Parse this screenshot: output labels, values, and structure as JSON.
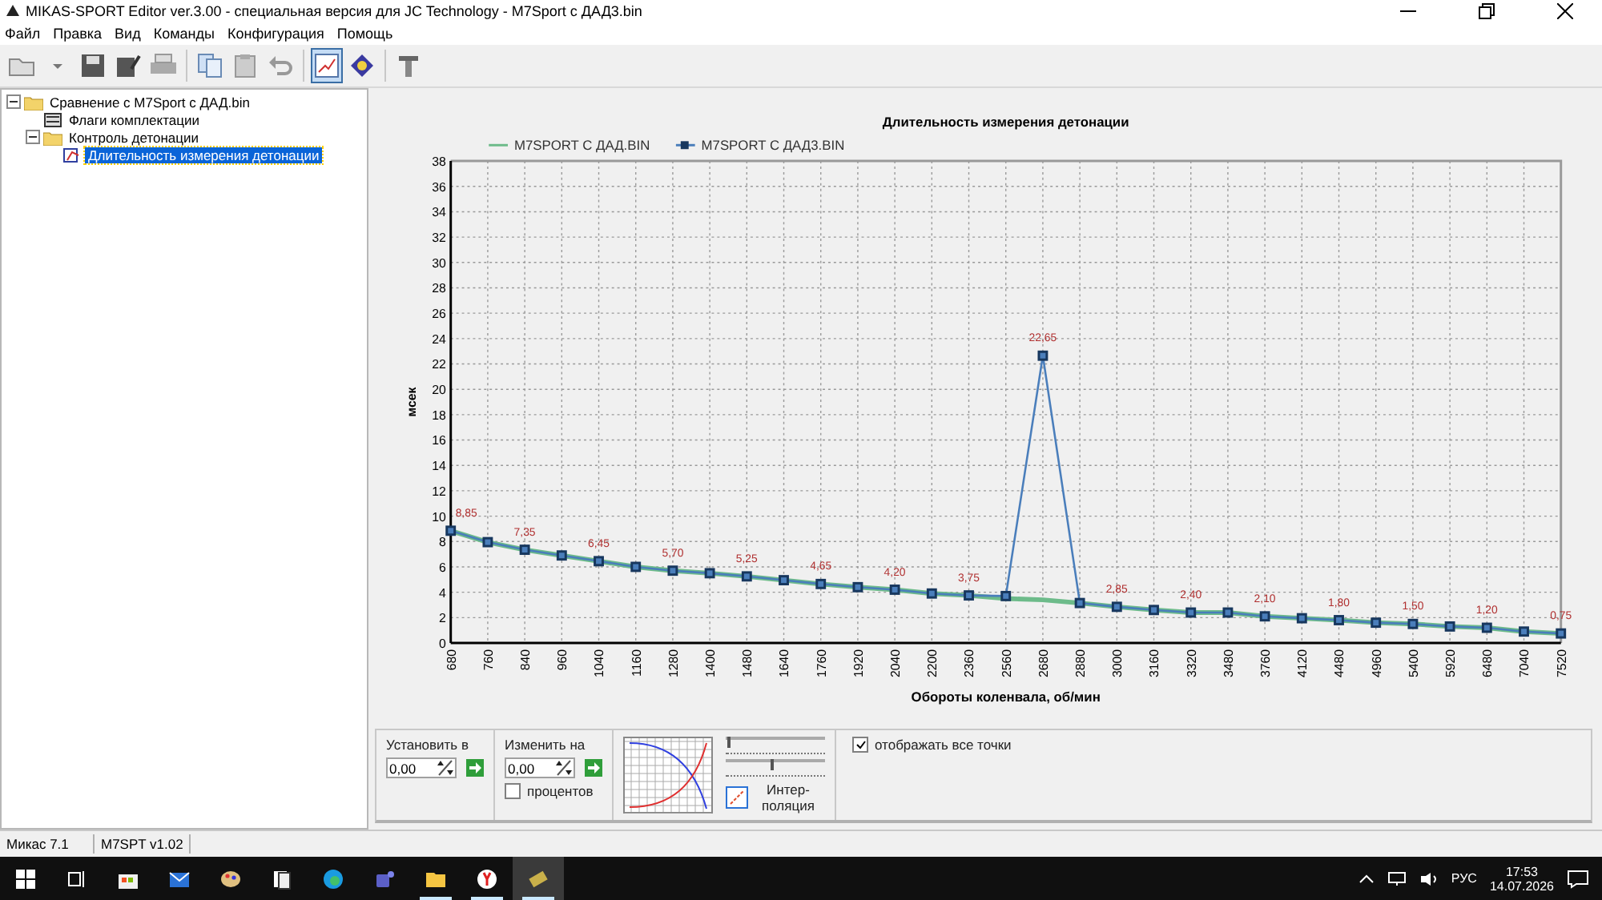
{
  "window": {
    "title": "MIKAS-SPORT Editor ver.3.00 - специальная версия для JC Technology - M7Sport с ДАД3.bin"
  },
  "menu": [
    "Файл",
    "Правка",
    "Вид",
    "Команды",
    "Конфигурация",
    "Помощь"
  ],
  "toolbar": [
    [
      {
        "kind": "open",
        "pressed": false
      },
      {
        "kind": "caret",
        "pressed": false
      },
      {
        "kind": "save",
        "pressed": false
      },
      {
        "kind": "saveas",
        "pressed": false
      },
      {
        "kind": "print",
        "pressed": false
      }
    ],
    [
      {
        "kind": "copy",
        "pressed": false
      },
      {
        "kind": "paste",
        "pressed": false
      },
      {
        "kind": "undo",
        "pressed": false
      }
    ],
    [
      {
        "kind": "chart",
        "pressed": true
      },
      {
        "kind": "info",
        "pressed": false
      }
    ],
    [
      {
        "kind": "tool",
        "pressed": false
      }
    ]
  ],
  "tree": [
    {
      "label": "Сравнение с M7Sport с ДАД.bin",
      "kind": "folder",
      "expanded": true,
      "selected": false,
      "children": [
        {
          "label": "Флаги комплектации",
          "kind": "flags",
          "selected": false
        },
        {
          "label": "Контроль детонации",
          "kind": "folder",
          "expanded": true,
          "selected": false,
          "children": [
            {
              "label": "Длительность измерения детонации",
              "kind": "chart",
              "selected": true
            }
          ]
        }
      ]
    }
  ],
  "chart_data": {
    "type": "line",
    "title": "Длительность измерения детонации",
    "xlabel": "Обороты коленвала, об/мин",
    "ylabel": "мсек",
    "grid": true,
    "legend": true,
    "categories": [
      "680",
      "760",
      "840",
      "960",
      "1040",
      "1160",
      "1280",
      "1400",
      "1480",
      "1640",
      "1760",
      "1920",
      "2040",
      "2200",
      "2360",
      "2560",
      "2680",
      "2880",
      "3000",
      "3160",
      "3320",
      "3480",
      "3760",
      "4120",
      "4480",
      "4960",
      "5400",
      "5920",
      "6480",
      "7040",
      "7520"
    ],
    "series": [
      {
        "name": "M7SPORT С ДАД.BIN",
        "color": "#6dbb8a",
        "marker": "none",
        "values": [
          8.85,
          7.95,
          7.35,
          6.9,
          6.45,
          6.0,
          5.7,
          5.5,
          5.25,
          4.95,
          4.65,
          4.4,
          4.2,
          3.9,
          3.75,
          3.5,
          3.4,
          3.15,
          2.85,
          2.6,
          2.4,
          2.4,
          2.1,
          1.95,
          1.8,
          1.6,
          1.5,
          1.3,
          1.2,
          0.9,
          0.75
        ]
      },
      {
        "name": "M7SPORT С ДАД3.BIN",
        "color": "#4a7ebb",
        "marker": "square",
        "values": [
          8.85,
          7.95,
          7.35,
          6.9,
          6.45,
          6.0,
          5.7,
          5.5,
          5.25,
          4.95,
          4.65,
          4.4,
          4.2,
          3.9,
          3.75,
          3.7,
          22.65,
          3.15,
          2.85,
          2.6,
          2.4,
          2.4,
          2.1,
          1.95,
          1.8,
          1.6,
          1.5,
          1.3,
          1.2,
          0.9,
          0.75
        ]
      }
    ],
    "ylim": [
      0,
      38
    ],
    "yticks": [
      0,
      2,
      4,
      6,
      8,
      10,
      12,
      14,
      16,
      18,
      20,
      22,
      24,
      26,
      28,
      30,
      32,
      34,
      36,
      38
    ],
    "value_labels": [
      "8,85",
      null,
      "7,35",
      null,
      "6,45",
      null,
      "5,70",
      null,
      "5,25",
      null,
      "4,65",
      null,
      "4,20",
      null,
      "3,75",
      null,
      "22,65",
      null,
      "2,85",
      null,
      "2,40",
      null,
      "2,10",
      null,
      "1,80",
      null,
      "1,50",
      null,
      "1,20",
      null,
      "0,75"
    ]
  },
  "controls": {
    "set": {
      "label": "Установить в",
      "value": "0,00"
    },
    "change": {
      "label": "Изменить на",
      "value": "0,00"
    },
    "percent": {
      "label": "процентов",
      "checked": false
    },
    "sliders": [
      {
        "level": 0.02
      },
      {
        "level": 0.45
      }
    ],
    "interpolation": {
      "label": "Интер-поляция"
    },
    "show_all": {
      "label": "отображать все точки",
      "checked": true
    }
  },
  "status_bar": [
    "Микас 7.1",
    "M7SPT v1.02"
  ],
  "taskbar": {
    "apps": [
      {
        "kind": "start",
        "running": false,
        "selected": false
      },
      {
        "kind": "taskview",
        "running": false,
        "selected": false
      },
      {
        "kind": "store",
        "running": false,
        "selected": false
      },
      {
        "kind": "mail",
        "running": false,
        "selected": false
      },
      {
        "kind": "paint",
        "running": false,
        "selected": false
      },
      {
        "kind": "cards",
        "running": false,
        "selected": false
      },
      {
        "kind": "edge",
        "running": false,
        "selected": false
      },
      {
        "kind": "teams",
        "running": false,
        "selected": false
      },
      {
        "kind": "folder",
        "running": true,
        "selected": false
      },
      {
        "kind": "browser",
        "running": true,
        "selected": false
      },
      {
        "kind": "chip",
        "running": true,
        "selected": true
      }
    ],
    "language": "РУС",
    "time": "17:53",
    "date": "14.07.2026"
  }
}
